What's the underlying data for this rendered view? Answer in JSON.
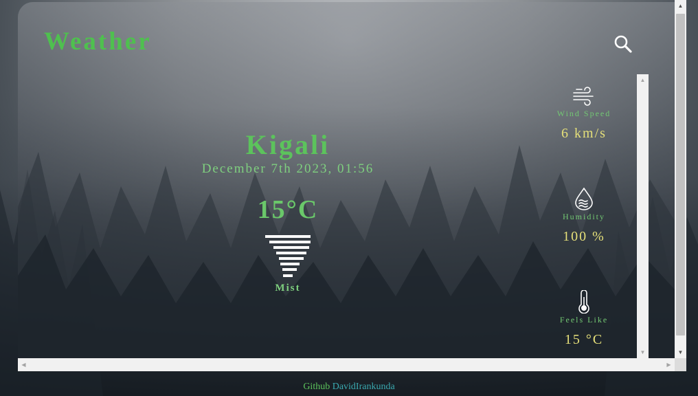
{
  "app": {
    "title": "Weather"
  },
  "search": {
    "icon": "search-icon"
  },
  "location": {
    "city": "Kigali",
    "datetime": "December 7th 2023, 01:56"
  },
  "current": {
    "temperature": "15°C",
    "condition": "Mist",
    "condition_icon": "tornado-mist-icon"
  },
  "details": [
    {
      "icon": "wind-icon",
      "label": "Wind Speed",
      "value": "6 km/s"
    },
    {
      "icon": "humidity-icon",
      "label": "Humidity",
      "value": "100 %"
    },
    {
      "icon": "thermometer-icon",
      "label": "Feels Like",
      "value": "15 °C"
    }
  ],
  "footer": {
    "prefix": "Github",
    "author": "DavidIrankunda"
  },
  "colors": {
    "accent": "#5cc35c",
    "value": "#e6e07a",
    "link": "#3aa9b0"
  }
}
